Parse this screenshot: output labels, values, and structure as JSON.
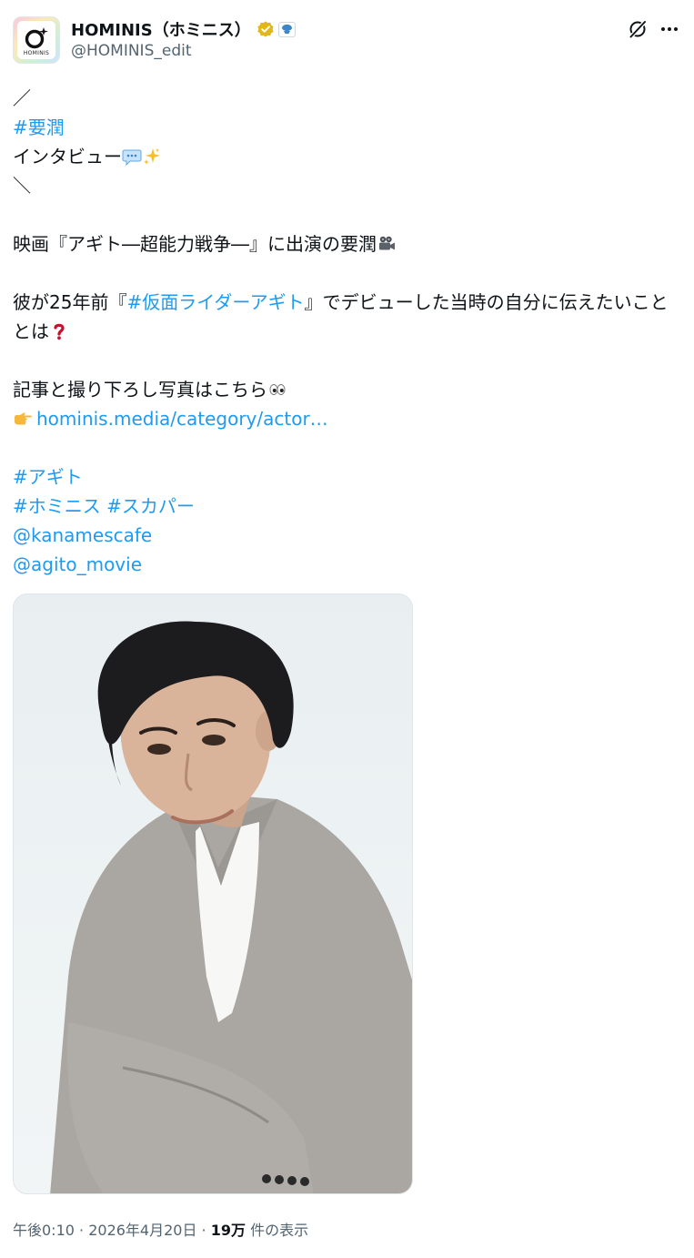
{
  "header": {
    "display_name": "HOMINIS（ホミニス）",
    "handle": "@HOMINIS_edit",
    "avatar_logo_text": "HOMINIS",
    "verified_badge_color": "#e2b719"
  },
  "body": {
    "line1": "／",
    "hashtag_kaname": "#要潤",
    "line3_text": "インタビュー",
    "line4": "＼",
    "line6": "映画『アギト―超能力戦争―』に出演の要潤",
    "line8_prefix": "彼が25年前『",
    "line8_hashtag": "#仮面ライダーアギト",
    "line8_suffix": "』でデビューした当時の自分に伝えたいこととは",
    "line10": "記事と撮り下ろし写真はこちら",
    "link_url": "hominis.media/category/actor…",
    "hashtag_agito": "#アギト",
    "hashtag_hominis": "#ホミニス",
    "hashtag_skyperfec": "#スカパー",
    "mention_kanamescafe": "@kanamescafe",
    "mention_agito_movie": "@agito_movie"
  },
  "footer": {
    "time": "午後0:10",
    "separator1": " · ",
    "date": "2026年4月20日",
    "separator2": " · ",
    "views": "19万",
    "views_label": " 件の表示"
  },
  "colors": {
    "link": "#1d9bf0",
    "text": "#0f1419",
    "muted": "#536471"
  },
  "icons": [
    "verified-badge-icon",
    "affiliate-badge-icon",
    "grok-icon",
    "more-icon",
    "speech-bubble-emoji",
    "sparkles-emoji",
    "movie-camera-emoji",
    "question-mark-emoji",
    "eyes-emoji",
    "pointing-right-emoji"
  ]
}
